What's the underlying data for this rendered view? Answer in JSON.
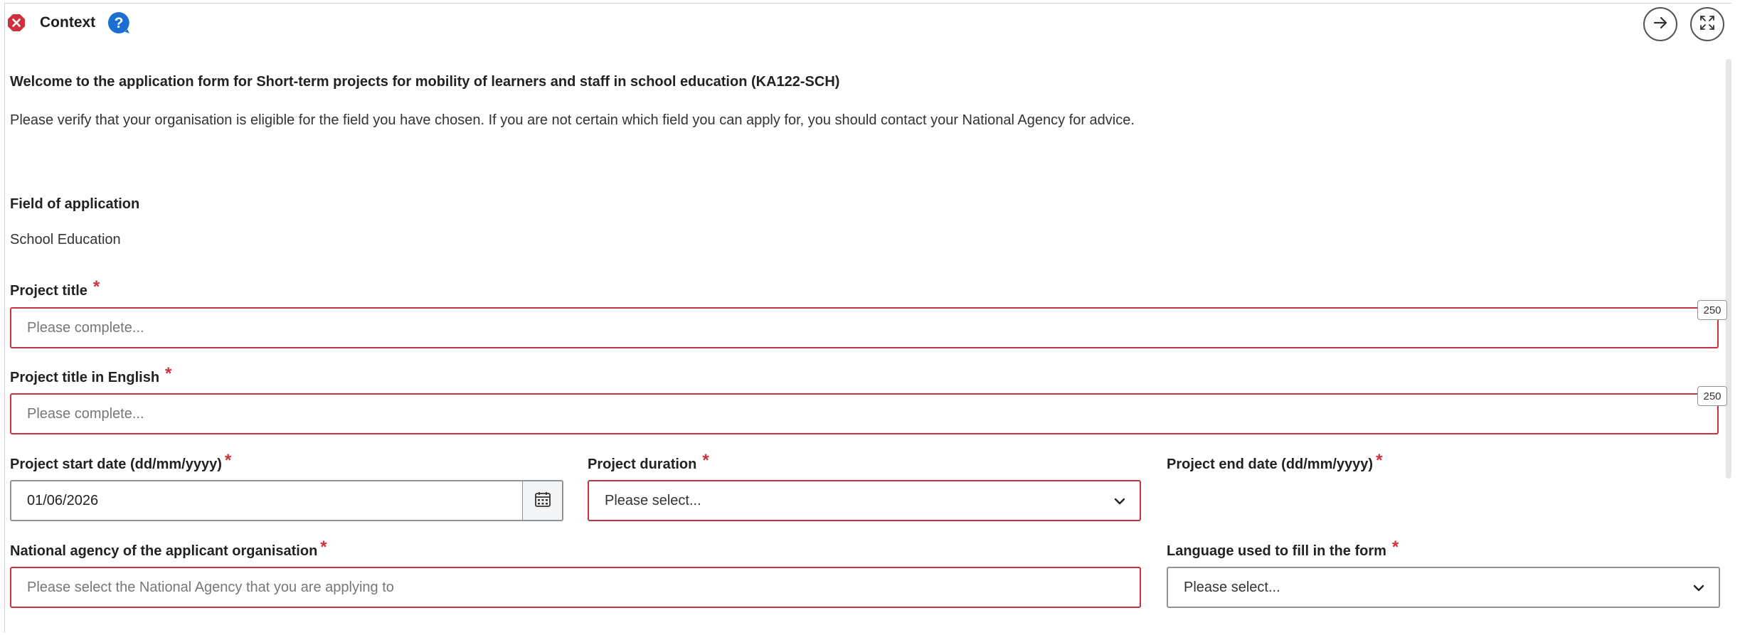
{
  "header": {
    "title": "Context",
    "status_icon": "error-icon",
    "help_icon": "question-circle-icon",
    "next_icon": "arrow-right-icon",
    "expand_icon": "expand-icon",
    "colors": {
      "error": "#d0303a",
      "help": "#1a6fd1"
    }
  },
  "intro": {
    "title": "Welcome to the application form for Short-term projects for mobility of learners and staff in school education (KA122-SCH)",
    "text": "Please verify that your organisation is eligible for the field you have chosen. If you are not certain which field you can apply for, you should contact your National Agency for advice."
  },
  "field_of_application": {
    "label": "Field of application",
    "value": "School Education"
  },
  "project_title": {
    "label": "Project title",
    "required": "*",
    "placeholder": "Please complete...",
    "counter": "250"
  },
  "project_title_en": {
    "label": "Project title in English",
    "required": "*",
    "placeholder": "Please complete...",
    "counter": "250"
  },
  "start_date": {
    "label": "Project start date (dd/mm/yyyy)",
    "required": "*",
    "value": "01/06/2026",
    "icon": "calendar-icon"
  },
  "duration": {
    "label": "Project duration",
    "required": "*",
    "placeholder": "Please select..."
  },
  "end_date": {
    "label": "Project end date (dd/mm/yyyy)",
    "required": "*"
  },
  "national_agency": {
    "label": "National agency of the applicant organisation",
    "required": "*",
    "placeholder": "Please select the National Agency that you are applying to"
  },
  "language": {
    "label": "Language used to fill in the form",
    "required": "*",
    "placeholder": "Please select..."
  }
}
